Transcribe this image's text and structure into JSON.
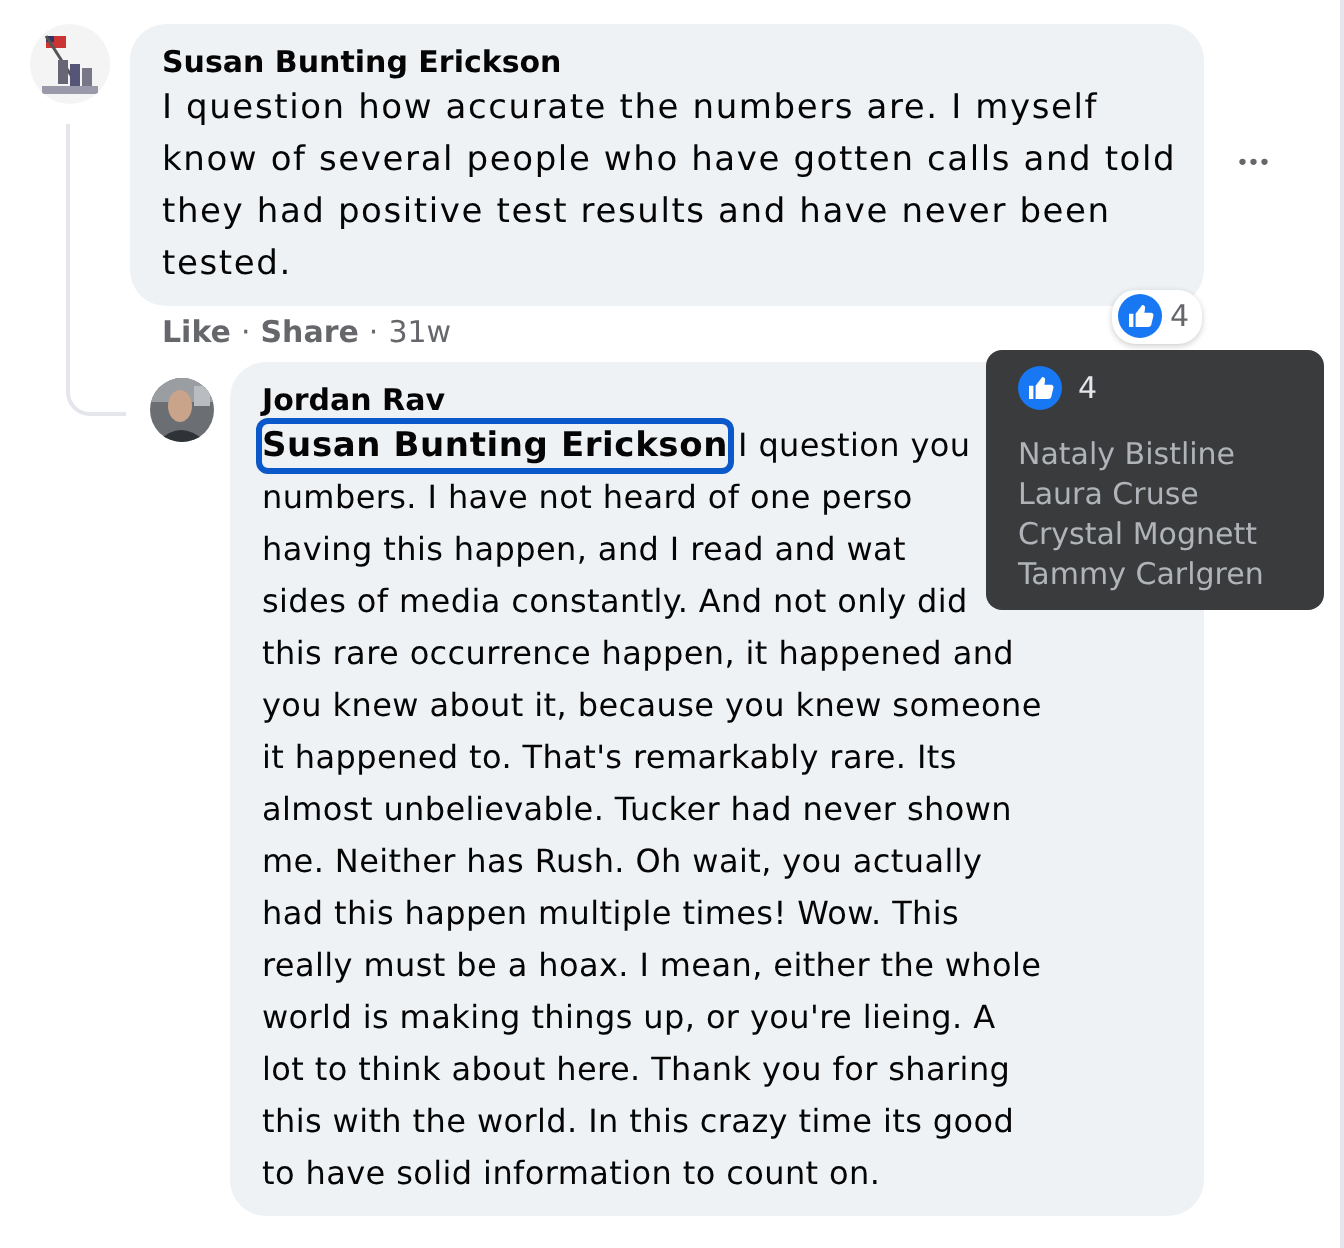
{
  "comment": {
    "author": "Susan Bunting Erickson",
    "text": "I question how accurate the numbers are. I myself know of several people who have gotten calls and told they had positive test results and have never been tested.",
    "actions": [
      "Like",
      "Share"
    ],
    "separator": "·",
    "age": "31w",
    "reaction_count": "4",
    "more": "•••"
  },
  "reply": {
    "author": "Jordan Rav",
    "mention": "Susan Bunting Erickson",
    "mention_focused": true,
    "lines": [
      "I question you",
      "numbers. I have not heard of one perso",
      "having this happen, and I read and wat",
      "sides of media constantly. And not only did",
      "this rare occurrence happen, it happened and",
      "you knew about it, because you knew someone",
      "it happened to. That's remarkably rare. Its",
      "almost unbelievable. Tucker had never shown",
      "me. Neither has Rush. Oh wait, you actually",
      "had this happen multiple times! Wow. This",
      "really must be a hoax. I mean, either the whole",
      "world is making things up, or you're lieing. A",
      "lot to think about here. Thank you for sharing",
      "this with the world. In this crazy time its good",
      "to have solid information to count on."
    ]
  },
  "tooltip": {
    "count": "4",
    "names": [
      "Nataly Bistline",
      "Laura Cruse",
      "Crystal Mognett",
      "Tammy Carlgren"
    ]
  }
}
